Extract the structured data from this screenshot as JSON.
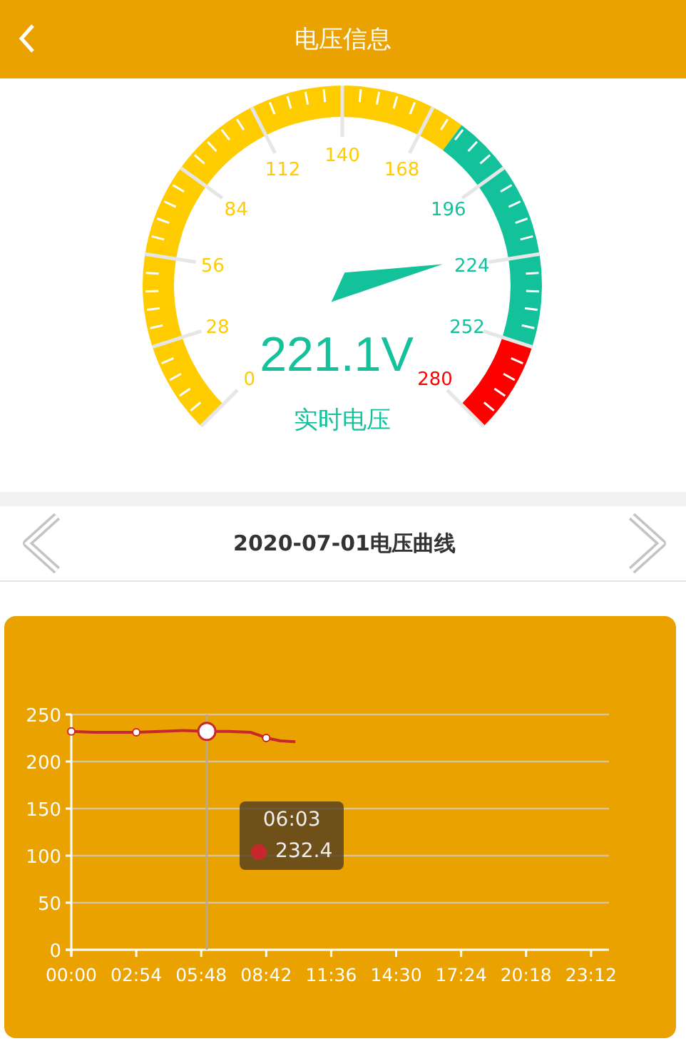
{
  "header": {
    "title": "电压信息"
  },
  "gauge": {
    "tick_labels": [
      "0",
      "28",
      "56",
      "84",
      "112",
      "140",
      "168",
      "196",
      "224",
      "252",
      "280"
    ],
    "segments": [
      {
        "color": "#ffcc00"
      },
      {
        "color": "#13c29a"
      },
      {
        "color": "#ff0000"
      }
    ],
    "reading": "221.1V",
    "caption": "实时电压"
  },
  "date_nav": {
    "title": "2020-07-01电压曲线"
  },
  "chart": {
    "chart_data": {
      "type": "line",
      "x": [
        0,
        60,
        120,
        174,
        240,
        300,
        363,
        420,
        480,
        510,
        522,
        560,
        600
      ],
      "series": [
        {
          "color": "#c8282d",
          "values": [
            232,
            231,
            231,
            231,
            232,
            233,
            232,
            232,
            231,
            227,
            225,
            222,
            221
          ]
        }
      ],
      "xlim": [
        0,
        1440
      ],
      "ylim": [
        0,
        250
      ],
      "grid": true,
      "ref_lines": [
        {
          "axis": "x",
          "value": 363
        }
      ],
      "xticks": [
        {
          "value": 0,
          "label": "00:00"
        },
        {
          "value": 174,
          "label": "02:54"
        },
        {
          "value": 348,
          "label": "05:48"
        },
        {
          "value": 522,
          "label": "08:42"
        },
        {
          "value": 696,
          "label": "11:36"
        },
        {
          "value": 870,
          "label": "14:30"
        },
        {
          "value": 1044,
          "label": "17:24"
        },
        {
          "value": 1218,
          "label": "20:18"
        },
        {
          "value": 1392,
          "label": "23:12"
        }
      ],
      "yticks": [
        0,
        50,
        100,
        150,
        200,
        250
      ]
    },
    "tooltip": {
      "time": "06:03",
      "value": "232.4"
    }
  }
}
